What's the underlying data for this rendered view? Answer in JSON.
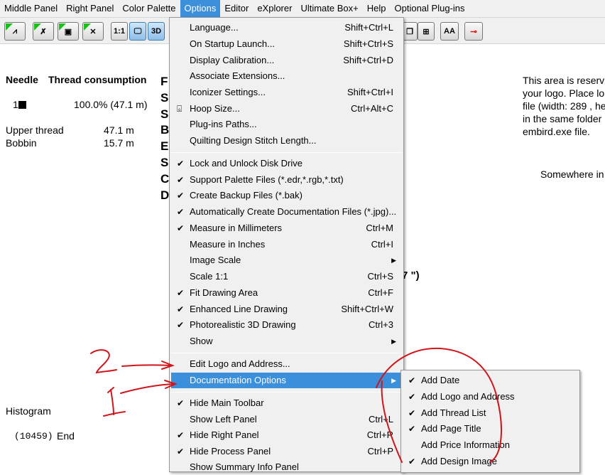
{
  "menubar": [
    "Middle Panel",
    "Right Panel",
    "Color Palette",
    "Options",
    "Editor",
    "eXplorer",
    "Ultimate Box+",
    "Help",
    "Optional Plug-ins"
  ],
  "toolbar": {
    "one_to_one": "1:1",
    "three_d": "3D",
    "font_btn": "AA"
  },
  "left": {
    "header_needle": "Needle",
    "header_consumption": "Thread consumption",
    "needle_num": "1",
    "needle_value": "100.0% (47.1 m)",
    "upper_label": "Upper thread",
    "upper_value": "47.1 m",
    "bobbin_label": "Bobbin",
    "bobbin_value": "15.7 m",
    "histogram": "Histogram",
    "end_code": "(10459)",
    "end_label": "End"
  },
  "middle": {
    "letters": [
      "F",
      "S",
      "S",
      "B",
      "E",
      "S",
      "C",
      "D"
    ],
    "size_fragment": "7 \")"
  },
  "right": {
    "logo_lines": [
      "This area is reserv",
      "your logo. Place lo",
      "file (width: 289 , he",
      "in the same folder",
      "embird.exe file."
    ],
    "address": "Somewhere in"
  },
  "options_menu": [
    {
      "label": "Language...",
      "shortcut": "Shift+Ctrl+L"
    },
    {
      "label": "On Startup Launch...",
      "shortcut": "Shift+Ctrl+S"
    },
    {
      "label": "Display Calibration...",
      "shortcut": "Shift+Ctrl+D"
    },
    {
      "label": "Associate Extensions...",
      "shortcut": ""
    },
    {
      "label": "Iconizer Settings...",
      "shortcut": "Shift+Ctrl+I"
    },
    {
      "label": "Hoop Size...",
      "shortcut": "Ctrl+Alt+C"
    },
    {
      "label": "Plug-ins Paths...",
      "shortcut": ""
    },
    {
      "label": "Quilting Design Stitch Length...",
      "shortcut": ""
    },
    {
      "label": "Lock and Unlock Disk Drive",
      "shortcut": "",
      "checked": true
    },
    {
      "label": "Support Palette Files (*.edr,*.rgb,*.txt)",
      "shortcut": "",
      "checked": true
    },
    {
      "label": "Create Backup Files (*.bak)",
      "shortcut": "",
      "checked": true
    },
    {
      "label": "Automatically Create Documentation Files (*.jpg)...",
      "shortcut": "",
      "checked": true
    },
    {
      "label": "Measure in Millimeters",
      "shortcut": "Ctrl+M",
      "checked": true
    },
    {
      "label": "Measure in Inches",
      "shortcut": "Ctrl+I"
    },
    {
      "label": "Image Scale",
      "shortcut": "",
      "submenu": true
    },
    {
      "label": "Scale 1:1",
      "shortcut": "Ctrl+S"
    },
    {
      "label": "Fit Drawing Area",
      "shortcut": "Ctrl+F",
      "checked": true
    },
    {
      "label": "Enhanced Line Drawing",
      "shortcut": "Shift+Ctrl+W",
      "checked": true
    },
    {
      "label": "Photorealistic 3D Drawing",
      "shortcut": "Ctrl+3",
      "checked": true
    },
    {
      "label": "Show",
      "shortcut": "",
      "submenu": true
    },
    {
      "label": "Edit Logo and Address...",
      "shortcut": ""
    },
    {
      "label": "Documentation Options",
      "shortcut": "",
      "submenu": true,
      "highlighted": true
    },
    {
      "label": "Hide Main Toolbar",
      "shortcut": "",
      "checked": true
    },
    {
      "label": "Show Left Panel",
      "shortcut": "Ctrl+L"
    },
    {
      "label": "Hide Right Panel",
      "shortcut": "Ctrl+R",
      "checked": true
    },
    {
      "label": "Hide Process Panel",
      "shortcut": "Ctrl+P",
      "checked": true
    },
    {
      "label": "Show Summary Info Panel",
      "shortcut": ""
    }
  ],
  "doc_submenu": [
    {
      "label": "Add Date",
      "checked": true
    },
    {
      "label": "Add Logo and Address",
      "checked": true
    },
    {
      "label": "Add Thread List",
      "checked": true
    },
    {
      "label": "Add Page Title",
      "checked": true
    },
    {
      "label": "Add Price Information",
      "checked": false
    },
    {
      "label": "Add Design Image",
      "checked": true
    }
  ],
  "annotations": {
    "label_2": "2",
    "label_1": "1"
  },
  "colors": {
    "highlight": "#3c8fdb",
    "annotation": "#d0151b",
    "menu_bg": "#f0f0f0"
  }
}
